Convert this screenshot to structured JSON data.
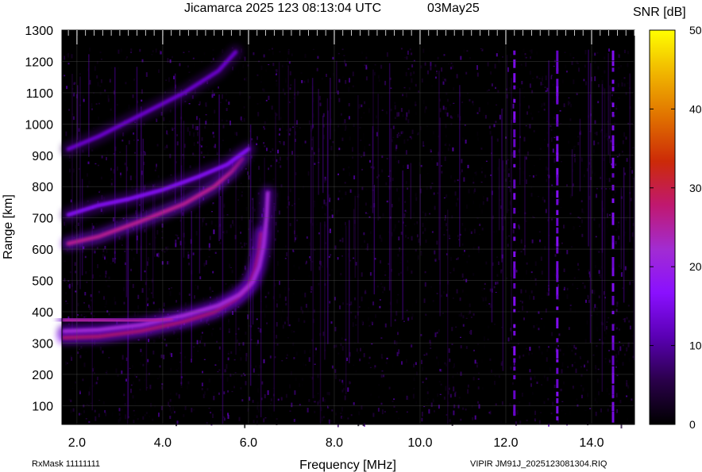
{
  "title": "Jicamarca 2025 123 08:13:04 UTC",
  "date_label": "03May25",
  "footer": {
    "rxmask": "RxMask 11111111",
    "file": "VIPIR  JM91J_2025123081304.RIQ"
  },
  "colorbar": {
    "label": "SNR [dB]",
    "min": 0,
    "max": 50,
    "ticks": [
      0,
      10,
      20,
      30,
      40,
      50
    ],
    "colors": [
      "#000000",
      "#2a004a",
      "#5a00b4",
      "#8a10ff",
      "#a22cd2",
      "#c01870",
      "#cc2a08",
      "#e07000",
      "#f0b400",
      "#ffff00"
    ]
  },
  "chart_data": {
    "type": "heatmap",
    "title": "Jicamarca 2025 123 08:13:04 UTC",
    "xlabel": "Frequency [MHz]",
    "ylabel": "Range [km]",
    "xlim": [
      1.65,
      15.0
    ],
    "ylim": [
      40,
      1300
    ],
    "data_range_top": 1245,
    "xticks": [
      "2.0",
      "4.0",
      "6.0",
      "8.0",
      "10.0",
      "12.0",
      "14.0"
    ],
    "xtick_values": [
      2.0,
      4.0,
      6.0,
      8.0,
      10.0,
      12.0,
      14.0
    ],
    "yticks": [
      "100",
      "200",
      "300",
      "400",
      "500",
      "600",
      "700",
      "800",
      "900",
      "1000",
      "1100",
      "1200",
      "1300"
    ],
    "ytick_values": [
      100,
      200,
      300,
      400,
      500,
      600,
      700,
      800,
      900,
      1000,
      1100,
      1200,
      1300
    ],
    "grid": true,
    "traces": [
      {
        "name": "",
        "snr": 30,
        "points": [
          [
            1.7,
            318
          ],
          [
            2.5,
            322
          ],
          [
            3.5,
            340
          ],
          [
            4.5,
            370
          ],
          [
            5.2,
            400
          ],
          [
            5.7,
            440
          ],
          [
            6.0,
            480
          ],
          [
            6.15,
            530
          ],
          [
            6.25,
            590
          ],
          [
            6.3,
            650
          ]
        ]
      },
      {
        "name": "",
        "snr": 22,
        "points": [
          [
            1.7,
            338
          ],
          [
            2.5,
            342
          ],
          [
            3.5,
            358
          ],
          [
            4.5,
            388
          ],
          [
            5.3,
            420
          ],
          [
            5.8,
            455
          ],
          [
            6.1,
            495
          ],
          [
            6.25,
            545
          ],
          [
            6.35,
            610
          ],
          [
            6.42,
            700
          ],
          [
            6.45,
            780
          ]
        ]
      },
      {
        "name": "",
        "snr": 25,
        "points": [
          [
            1.7,
            372
          ],
          [
            2.5,
            372
          ],
          [
            3.2,
            370
          ],
          [
            3.8,
            372
          ],
          [
            4.2,
            378
          ]
        ]
      },
      {
        "name": "",
        "snr": 26,
        "points": [
          [
            1.8,
            618
          ],
          [
            2.5,
            640
          ],
          [
            3.5,
            690
          ],
          [
            4.5,
            745
          ],
          [
            5.2,
            800
          ],
          [
            5.6,
            848
          ],
          [
            5.85,
            890
          ]
        ]
      },
      {
        "name": "",
        "snr": 16,
        "points": [
          [
            1.8,
            710
          ],
          [
            2.5,
            740
          ],
          [
            3.2,
            760
          ],
          [
            4.0,
            790
          ],
          [
            4.8,
            830
          ],
          [
            5.5,
            870
          ],
          [
            6.0,
            920
          ]
        ]
      },
      {
        "name": "",
        "snr": 13,
        "points": [
          [
            1.8,
            920
          ],
          [
            2.5,
            960
          ],
          [
            3.5,
            1030
          ],
          [
            4.5,
            1100
          ],
          [
            5.3,
            1170
          ],
          [
            5.7,
            1230
          ]
        ]
      }
    ],
    "interference_lines_mhz": [
      12.2,
      13.2,
      14.5
    ]
  }
}
